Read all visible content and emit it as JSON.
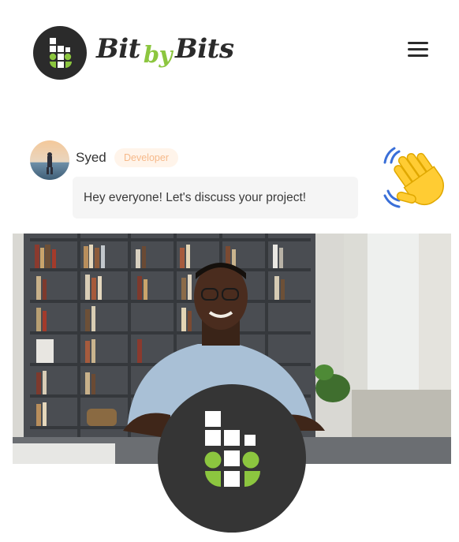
{
  "header": {
    "brand_left": "Bit",
    "brand_mid": "by",
    "brand_right": "Bits"
  },
  "chat": {
    "author": "Syed",
    "role": "Developer",
    "message": "Hey everyone! Let's discuss your project!"
  },
  "icons": {
    "logo": "bit-by-bits-logo-icon",
    "menu": "hamburger-menu-icon",
    "wave": "waving-hand-icon"
  },
  "colors": {
    "brand_dark": "#2b2b2b",
    "brand_green": "#8cc63f",
    "badge_text": "#f6b98a",
    "badge_bg": "#fff4ea",
    "bubble_bg": "#f5f5f5"
  }
}
